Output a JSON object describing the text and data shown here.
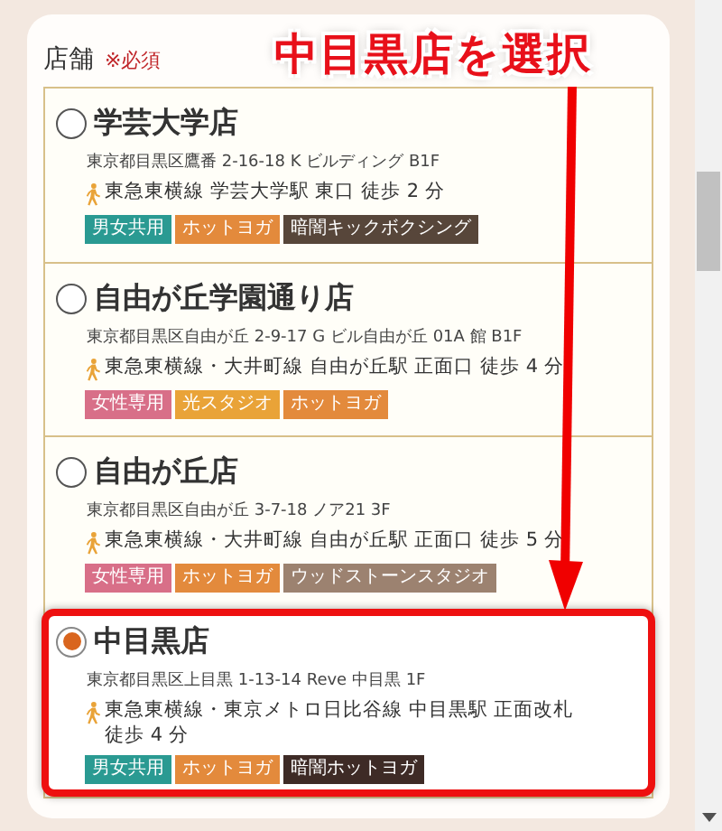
{
  "field": {
    "label": "店舗",
    "required": "※必須"
  },
  "stores": [
    {
      "name": "学芸大学店",
      "selected": false,
      "address": "東京都目黒区鷹番 2-16-18 K ビルディング B1F",
      "route": "東急東横線 学芸大学駅 東口 徒歩 2 分",
      "tags": [
        {
          "text": "男女共用",
          "color": "#2a9a92"
        },
        {
          "text": "ホットヨガ",
          "color": "#e38a3c"
        },
        {
          "text": "暗闇キックボクシング",
          "color": "#57463a"
        }
      ]
    },
    {
      "name": "自由が丘学園通り店",
      "selected": false,
      "address": "東京都目黒区自由が丘 2-9-17 G ビル自由が丘 01A 館 B1F",
      "route": "東急東横線・大井町線 自由が丘駅 正面口 徒歩 4 分",
      "tags": [
        {
          "text": "女性専用",
          "color": "#d86f88"
        },
        {
          "text": "光スタジオ",
          "color": "#e9a338"
        },
        {
          "text": "ホットヨガ",
          "color": "#e38a3c"
        }
      ]
    },
    {
      "name": "自由が丘店",
      "selected": false,
      "address": "東京都目黒区自由が丘 3-7-18 ノア21 3F",
      "route": "東急東横線・大井町線 自由が丘駅 正面口 徒歩 5 分",
      "tags": [
        {
          "text": "女性専用",
          "color": "#d86f88"
        },
        {
          "text": "ホットヨガ",
          "color": "#e38a3c"
        },
        {
          "text": "ウッドストーンスタジオ",
          "color": "#9c8270"
        }
      ]
    },
    {
      "name": "中目黒店",
      "selected": true,
      "address": "東京都目黒区上目黒 1-13-14 Reve 中目黒 1F",
      "route": "東急東横線・東京メトロ日比谷線 中目黒駅 正面改札徒歩 4 分",
      "tags": [
        {
          "text": "男女共用",
          "color": "#2a9a92"
        },
        {
          "text": "ホットヨガ",
          "color": "#e38a3c"
        },
        {
          "text": "暗闇ホットヨガ",
          "color": "#3e2b26"
        }
      ]
    }
  ],
  "annotation": {
    "text": "中目黒店を選択"
  }
}
